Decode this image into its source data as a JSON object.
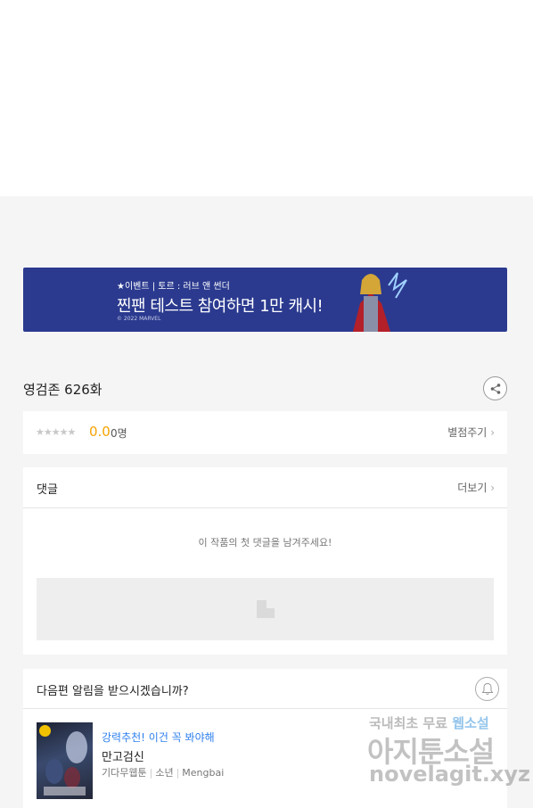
{
  "banner": {
    "event_line": "★이벤트 | 토르 : 러브 앤 썬더",
    "headline": "찐팬 테스트 참여하면 1만 캐시!",
    "copyright": "© 2022 MARVEL"
  },
  "episode": {
    "title": "영검존 626화",
    "share_icon": "share-icon"
  },
  "rating": {
    "stars": "★★★★★",
    "score": "0.0",
    "votes": "0명",
    "rate_link": "별점주기"
  },
  "comments": {
    "label": "댓글",
    "more_link": "더보기",
    "empty_message": "이 작품의 첫 댓글을 남겨주세요!"
  },
  "notify": {
    "question": "다음편 알림을 받으시겠습니까?",
    "bell_icon": "bell-icon"
  },
  "recommendation": {
    "label": "강력추천! 이건 꼭 봐야해",
    "title": "만고검신",
    "genre": "기다무웹툰",
    "category": "소년",
    "author": "Mengbai",
    "accent_color": "#2f80ed"
  },
  "watermark": {
    "line1_a": "국내최초 무료",
    "line1_b": "웹소설",
    "line2": "아지툰소설",
    "line3": "novelagit.xyz"
  }
}
